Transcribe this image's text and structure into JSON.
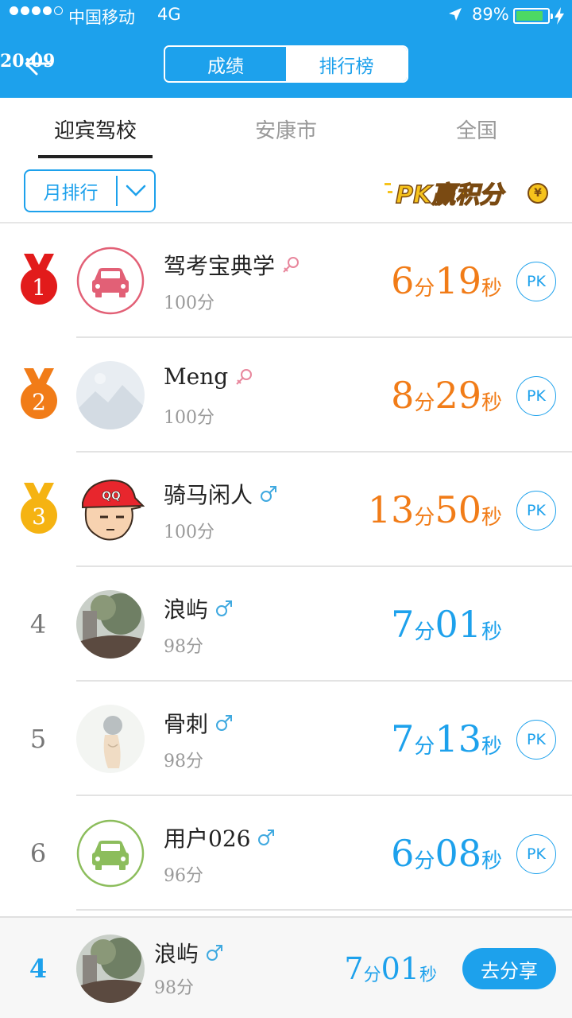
{
  "status_bar": {
    "carrier": "中国移动",
    "network": "4G",
    "time": "20:09",
    "battery": "89%"
  },
  "header": {
    "segments": [
      {
        "label": "成绩",
        "active": true
      },
      {
        "label": "排行榜",
        "active": false
      }
    ]
  },
  "tabs": [
    {
      "label": "迎宾驾校",
      "active": true
    },
    {
      "label": "安康市",
      "active": false
    },
    {
      "label": "全国",
      "active": false
    }
  ],
  "filter": {
    "label": "月排行"
  },
  "promo": {
    "label": "PK赢积分",
    "coin": "¥"
  },
  "colors": {
    "accent": "#1da1ec",
    "orange": "#f17c18",
    "gold": "#f6c31c",
    "female": "#e8869c",
    "male": "#3fa9e0"
  },
  "rows": [
    {
      "rank": "1",
      "name": "驾考宝典学",
      "gender": "female",
      "score": "100分",
      "min": "6",
      "min_unit": "分",
      "sec": "19",
      "sec_unit": "秒",
      "show_pk": true,
      "pk": "PK",
      "avatar": "car-red"
    },
    {
      "rank": "2",
      "name": "Meng",
      "gender": "female",
      "score": "100分",
      "min": "8",
      "min_unit": "分",
      "sec": "29",
      "sec_unit": "秒",
      "show_pk": true,
      "pk": "PK",
      "avatar": "placeholder"
    },
    {
      "rank": "3",
      "name": "骑马闲人",
      "gender": "male",
      "score": "100分",
      "min": "13",
      "min_unit": "分",
      "sec": "50",
      "sec_unit": "秒",
      "show_pk": true,
      "pk": "PK",
      "avatar": "cartoon-qq"
    },
    {
      "rank": "4",
      "name": "浪屿",
      "gender": "male",
      "score": "98分",
      "min": "7",
      "min_unit": "分",
      "sec": "01",
      "sec_unit": "秒",
      "show_pk": false,
      "pk": "PK",
      "avatar": "photo-trees"
    },
    {
      "rank": "5",
      "name": "骨刺",
      "gender": "male",
      "score": "98分",
      "min": "7",
      "min_unit": "分",
      "sec": "13",
      "sec_unit": "秒",
      "show_pk": true,
      "pk": "PK",
      "avatar": "sketch"
    },
    {
      "rank": "6",
      "name": "用户026",
      "gender": "male",
      "score": "96分",
      "min": "6",
      "min_unit": "分",
      "sec": "08",
      "sec_unit": "秒",
      "show_pk": true,
      "pk": "PK",
      "avatar": "car-green"
    }
  ],
  "me": {
    "rank": "4",
    "name": "浪屿",
    "gender": "male",
    "score": "98分",
    "min": "7",
    "min_unit": "分",
    "sec": "01",
    "sec_unit": "秒",
    "share_label": "去分享"
  }
}
